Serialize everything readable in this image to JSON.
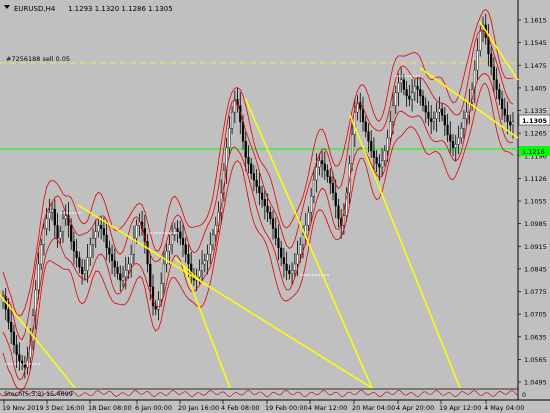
{
  "chart_data": {
    "type": "candlestick",
    "header": {
      "symbol_tf": "EURUSD,H4",
      "ohlc": "1.1293 1.1320 1.1286 1.1305"
    },
    "order_label": "#7256188 sell 0.05",
    "price_marker": "1.1305",
    "green_line_marker": "1.1216",
    "y_ticks": [
      "1.1615",
      "1.1545",
      "1.1475",
      "1.1405",
      "1.1335",
      "1.1265",
      "1.1196",
      "1.1126",
      "1.1055",
      "1.0985",
      "1.0915",
      "1.0845",
      "1.0775",
      "1.0705",
      "1.0635",
      "1.0565",
      "1.0495"
    ],
    "x_ticks": [
      "19 Nov 2019",
      "3 Dec 16:00",
      "18 Dec 08:00",
      "6 Jan 00:00",
      "20 Jan 16:00",
      "4 Feb 08:00",
      "19 Feb 00:00",
      "4 Mar 12:00",
      "20 Mar 04:00",
      "4 Apr 20:00",
      "19 Apr 12:00",
      "4 May 04:00"
    ],
    "indicator_label": "Stoch(5,3,3) 15.4699",
    "indicator_right_label": "0",
    "series_close": [
      1.076,
      1.072,
      1.068,
      1.065,
      1.061,
      1.058,
      1.056,
      1.055,
      1.054,
      1.057,
      1.062,
      1.07,
      1.078,
      1.086,
      1.092,
      1.097,
      1.1,
      1.102,
      1.103,
      1.098,
      1.094,
      1.096,
      1.1,
      1.101,
      1.098,
      1.093,
      1.09,
      1.088,
      1.085,
      1.083,
      1.084,
      1.088,
      1.092,
      1.094,
      1.096,
      1.098,
      1.097,
      1.095,
      1.091,
      1.089,
      1.087,
      1.085,
      1.083,
      1.081,
      1.082,
      1.084,
      1.086,
      1.089,
      1.094,
      1.098,
      1.099,
      1.097,
      1.093,
      1.086,
      1.079,
      1.073,
      1.072,
      1.075,
      1.08,
      1.086,
      1.09,
      1.092,
      1.095,
      1.097,
      1.096,
      1.094,
      1.092,
      1.089,
      1.086,
      1.083,
      1.081,
      1.082,
      1.084,
      1.086,
      1.087,
      1.089,
      1.092,
      1.095,
      1.098,
      1.102,
      1.108,
      1.115,
      1.122,
      1.128,
      1.133,
      1.137,
      1.135,
      1.13,
      1.124,
      1.119,
      1.117,
      1.114,
      1.112,
      1.11,
      1.108,
      1.106,
      1.104,
      1.102,
      1.1,
      1.097,
      1.094,
      1.091,
      1.088,
      1.086,
      1.084,
      1.083,
      1.084,
      1.086,
      1.089,
      1.092,
      1.095,
      1.098,
      1.102,
      1.107,
      1.112,
      1.116,
      1.118,
      1.117,
      1.115,
      1.113,
      1.111,
      1.108,
      1.104,
      1.1,
      1.098,
      1.101,
      1.108,
      1.117,
      1.126,
      1.133,
      1.136,
      1.134,
      1.13,
      1.127,
      1.124,
      1.121,
      1.119,
      1.117,
      1.116,
      1.118,
      1.121,
      1.125,
      1.13,
      1.135,
      1.139,
      1.142,
      1.143,
      1.14,
      1.138,
      1.137,
      1.139,
      1.141,
      1.14,
      1.138,
      1.135,
      1.133,
      1.131,
      1.13,
      1.131,
      1.133,
      1.134,
      1.132,
      1.129,
      1.126,
      1.124,
      1.122,
      1.123,
      1.125,
      1.128,
      1.131,
      1.133,
      1.136,
      1.14,
      1.146,
      1.152,
      1.158,
      1.16,
      1.156,
      1.151,
      1.147,
      1.143,
      1.14,
      1.137,
      1.134,
      1.132,
      1.13,
      1.129,
      1.13
    ]
  }
}
